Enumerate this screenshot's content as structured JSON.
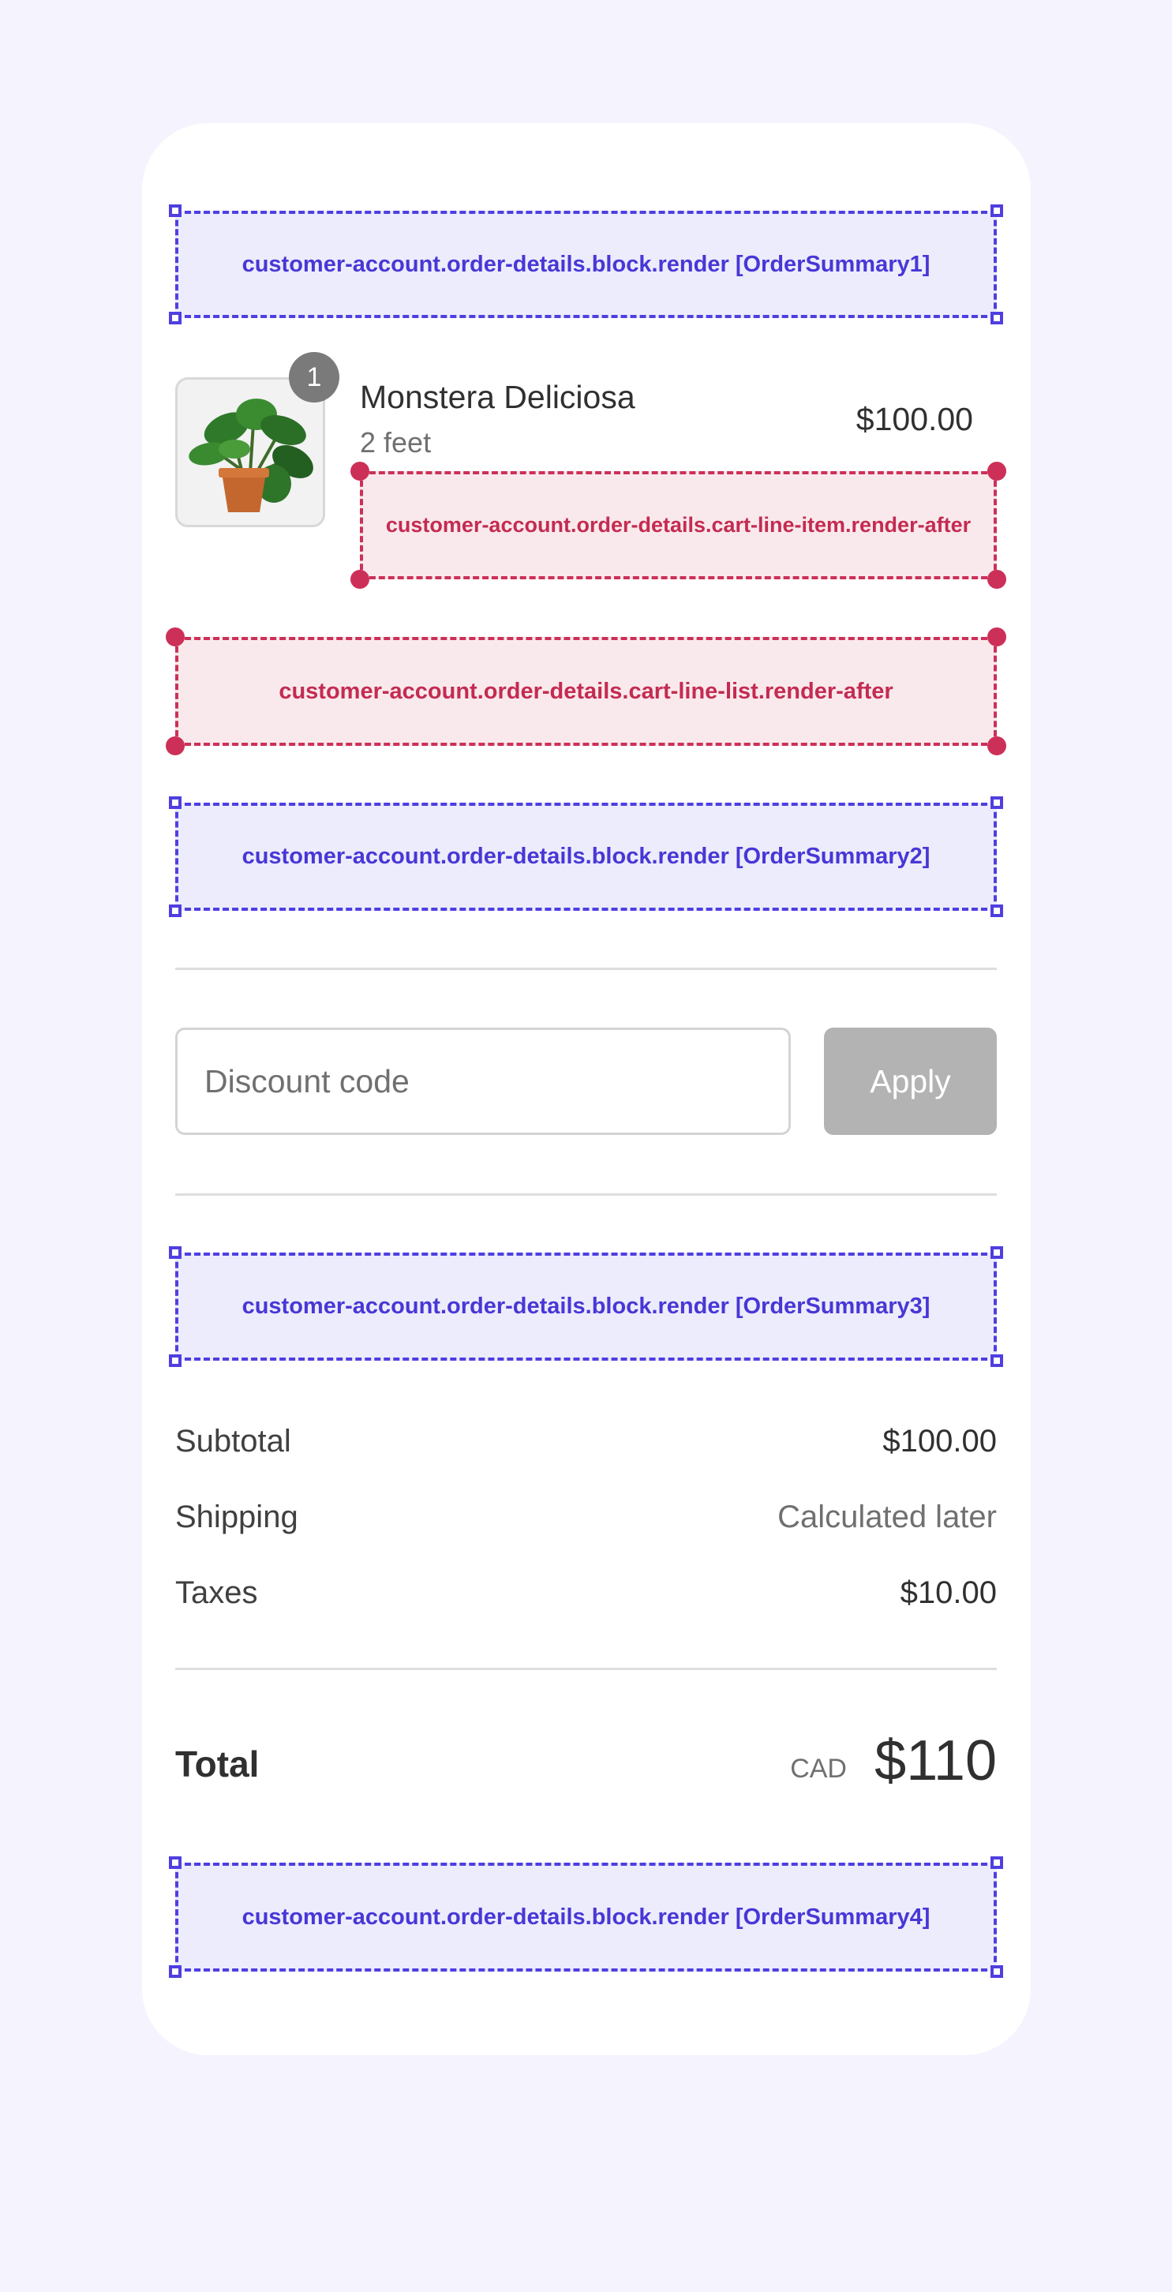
{
  "targets": {
    "order_summary_1": "customer-account.order-details.block.render [OrderSummary1]",
    "cart_line_item_after": "customer-account.order-details.cart-line-item.render-after",
    "cart_line_list_after": "customer-account.order-details.cart-line-list.render-after",
    "order_summary_2": "customer-account.order-details.block.render [OrderSummary2]",
    "order_summary_3": "customer-account.order-details.block.render [OrderSummary3]",
    "order_summary_4": "customer-account.order-details.block.render [OrderSummary4]"
  },
  "line_item": {
    "title": "Monstera Deliciosa",
    "variant": "2 feet",
    "price": "$100.00",
    "quantity": "1",
    "image_icon": "potted-plant-image"
  },
  "discount": {
    "placeholder": "Discount code",
    "value": "",
    "apply_label": "Apply"
  },
  "summary": {
    "subtotal_label": "Subtotal",
    "subtotal_value": "$100.00",
    "shipping_label": "Shipping",
    "shipping_value": "Calculated later",
    "taxes_label": "Taxes",
    "taxes_value": "$10.00",
    "total_label": "Total",
    "total_currency": "CAD",
    "total_value": "$110"
  },
  "colors": {
    "page_background": "#f4f3fe",
    "block_target": "#4f3fe0",
    "static_target": "#cc3058",
    "apply_button": "#b3b3b3"
  }
}
